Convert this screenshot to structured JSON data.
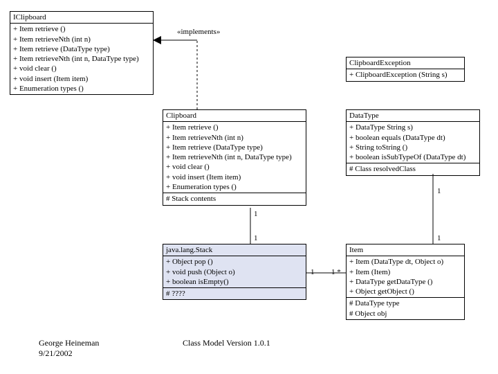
{
  "stereotype": "«implements»",
  "iclipboard": {
    "title": "IClipboard",
    "ops": [
      "+ Item retrieve ()",
      "+ Item retrieveNth (int n)",
      "+ Item retrieve (DataType type)",
      "+ Item retrieveNth (int n, DataType type)",
      "+ void clear ()",
      "+ void insert (Item item)",
      "+ Enumeration types ()"
    ]
  },
  "clipboardException": {
    "title": "ClipboardException",
    "ops": [
      "+ ClipboardException (String s)"
    ]
  },
  "clipboard": {
    "title": "Clipboard",
    "ops": [
      "+ Item retrieve ()",
      "+ Item retrieveNth (int n)",
      "+ Item retrieve (DataType type)",
      "+ Item retrieveNth (int n, DataType type)",
      "+ void clear ()",
      "+ void insert (Item item)",
      "+ Enumeration types ()"
    ],
    "attrs": "# Stack contents"
  },
  "dataType": {
    "title": "DataType",
    "ops": [
      "+ DataType String s)",
      "+ boolean equals (DataType dt)",
      "+ String toString ()",
      "+ boolean isSubTypeOf (DataType dt)"
    ],
    "attrs": "# Class resolvedClass"
  },
  "stack": {
    "title": "java.lang.Stack",
    "ops": [
      "+ Object pop ()",
      "+ void push (Object o)",
      "+ boolean isEmpty()"
    ],
    "attrs": "# ????"
  },
  "item": {
    "title": "Item",
    "ops": [
      "+ Item (DataType dt, Object o)",
      "+ Item (Item)",
      "+ DataType getDataType ()",
      "+ Object getObject ()"
    ],
    "attrs": [
      "#  DataType  type",
      "#  Object obj"
    ]
  },
  "mult": {
    "one": "1",
    "many": "1  *"
  },
  "footer": {
    "author": "George Heineman",
    "date": "9/21/2002",
    "version": "Class Model Version 1.0.1"
  }
}
